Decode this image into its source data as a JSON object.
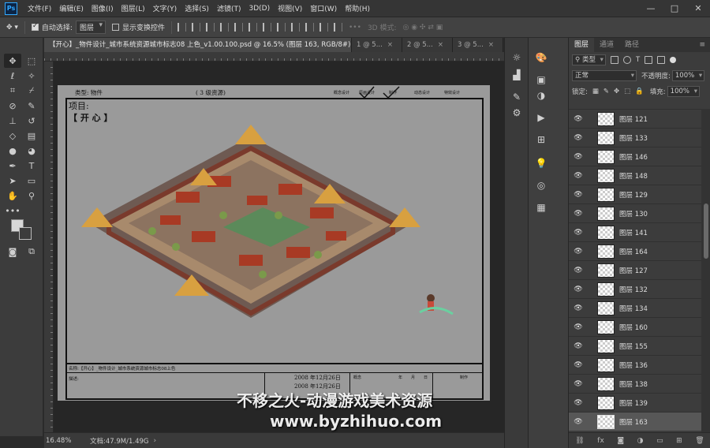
{
  "app": {
    "logo": "Ps"
  },
  "menu": [
    "文件(F)",
    "编辑(E)",
    "图像(I)",
    "图层(L)",
    "文字(Y)",
    "选择(S)",
    "滤镜(T)",
    "3D(D)",
    "视图(V)",
    "窗口(W)",
    "帮助(H)"
  ],
  "window_controls": {
    "minimize": "—",
    "maximize": "□",
    "close": "✕"
  },
  "options": {
    "auto_select_label": "自动选择:",
    "auto_select_value": "图层",
    "show_transform_label": "显示变换控件",
    "mode_3d_label": "3D 模式:"
  },
  "tabs": [
    {
      "label": "【开心】_物件设计_城市系统资源城市标志08 上色_v1.00.100.psd @ 16.5% (图层 163, RGB/8#)",
      "close": "×"
    },
    {
      "label": "1 @ 5...",
      "close": "×"
    },
    {
      "label": "2 @ 5...",
      "close": "×"
    },
    {
      "label": "3 @ 5...",
      "close": "×"
    }
  ],
  "document": {
    "type_label": "类型: 物件",
    "level_label": "(  3   级资源)",
    "header_cols": [
      "概念设计",
      "原画设计",
      "制作",
      "动态设计",
      "特效设计"
    ],
    "project_label": "项目:",
    "project_name": "【 开 心 】",
    "footer_name": "名称:【开心】_物件设计_城市系统资源城市标志08上色",
    "footer_desc": "描述:",
    "footer_dates": [
      "2008 年12月26日",
      "2008 年12月26日"
    ],
    "footer_cells": [
      "概念",
      "年",
      "月",
      "日",
      "制作"
    ]
  },
  "status": {
    "zoom": "16.48%",
    "doc_size": "文档:47.9M/1.49G",
    "arrow": "›"
  },
  "layers_panel": {
    "tabs": [
      "图层",
      "通道",
      "路径"
    ],
    "kind_filter": "类型",
    "blend_mode": "正常",
    "opacity_label": "不透明度:",
    "opacity_value": "100%",
    "lock_label": "锁定:",
    "fill_label": "填充:",
    "fill_value": "100%",
    "layers": [
      {
        "name": "图层 121",
        "visible": true
      },
      {
        "name": "图层 133",
        "visible": true
      },
      {
        "name": "图层 146",
        "visible": true
      },
      {
        "name": "图层 148",
        "visible": true
      },
      {
        "name": "图层 129",
        "visible": true
      },
      {
        "name": "图层 130",
        "visible": true
      },
      {
        "name": "图层 141",
        "visible": true
      },
      {
        "name": "图层 164",
        "visible": true
      },
      {
        "name": "图层 127",
        "visible": true
      },
      {
        "name": "图层 132",
        "visible": true
      },
      {
        "name": "图层 134",
        "visible": true
      },
      {
        "name": "图层 160",
        "visible": true
      },
      {
        "name": "图层 155",
        "visible": true
      },
      {
        "name": "图层 136",
        "visible": true
      },
      {
        "name": "图层 138",
        "visible": true
      },
      {
        "name": "图层 139",
        "visible": true
      },
      {
        "name": "图层 163",
        "visible": true,
        "selected": true
      }
    ]
  },
  "watermark": {
    "line1": "不移之火-动漫游戏美术资源",
    "line2": "www.byzhihuo.com"
  }
}
